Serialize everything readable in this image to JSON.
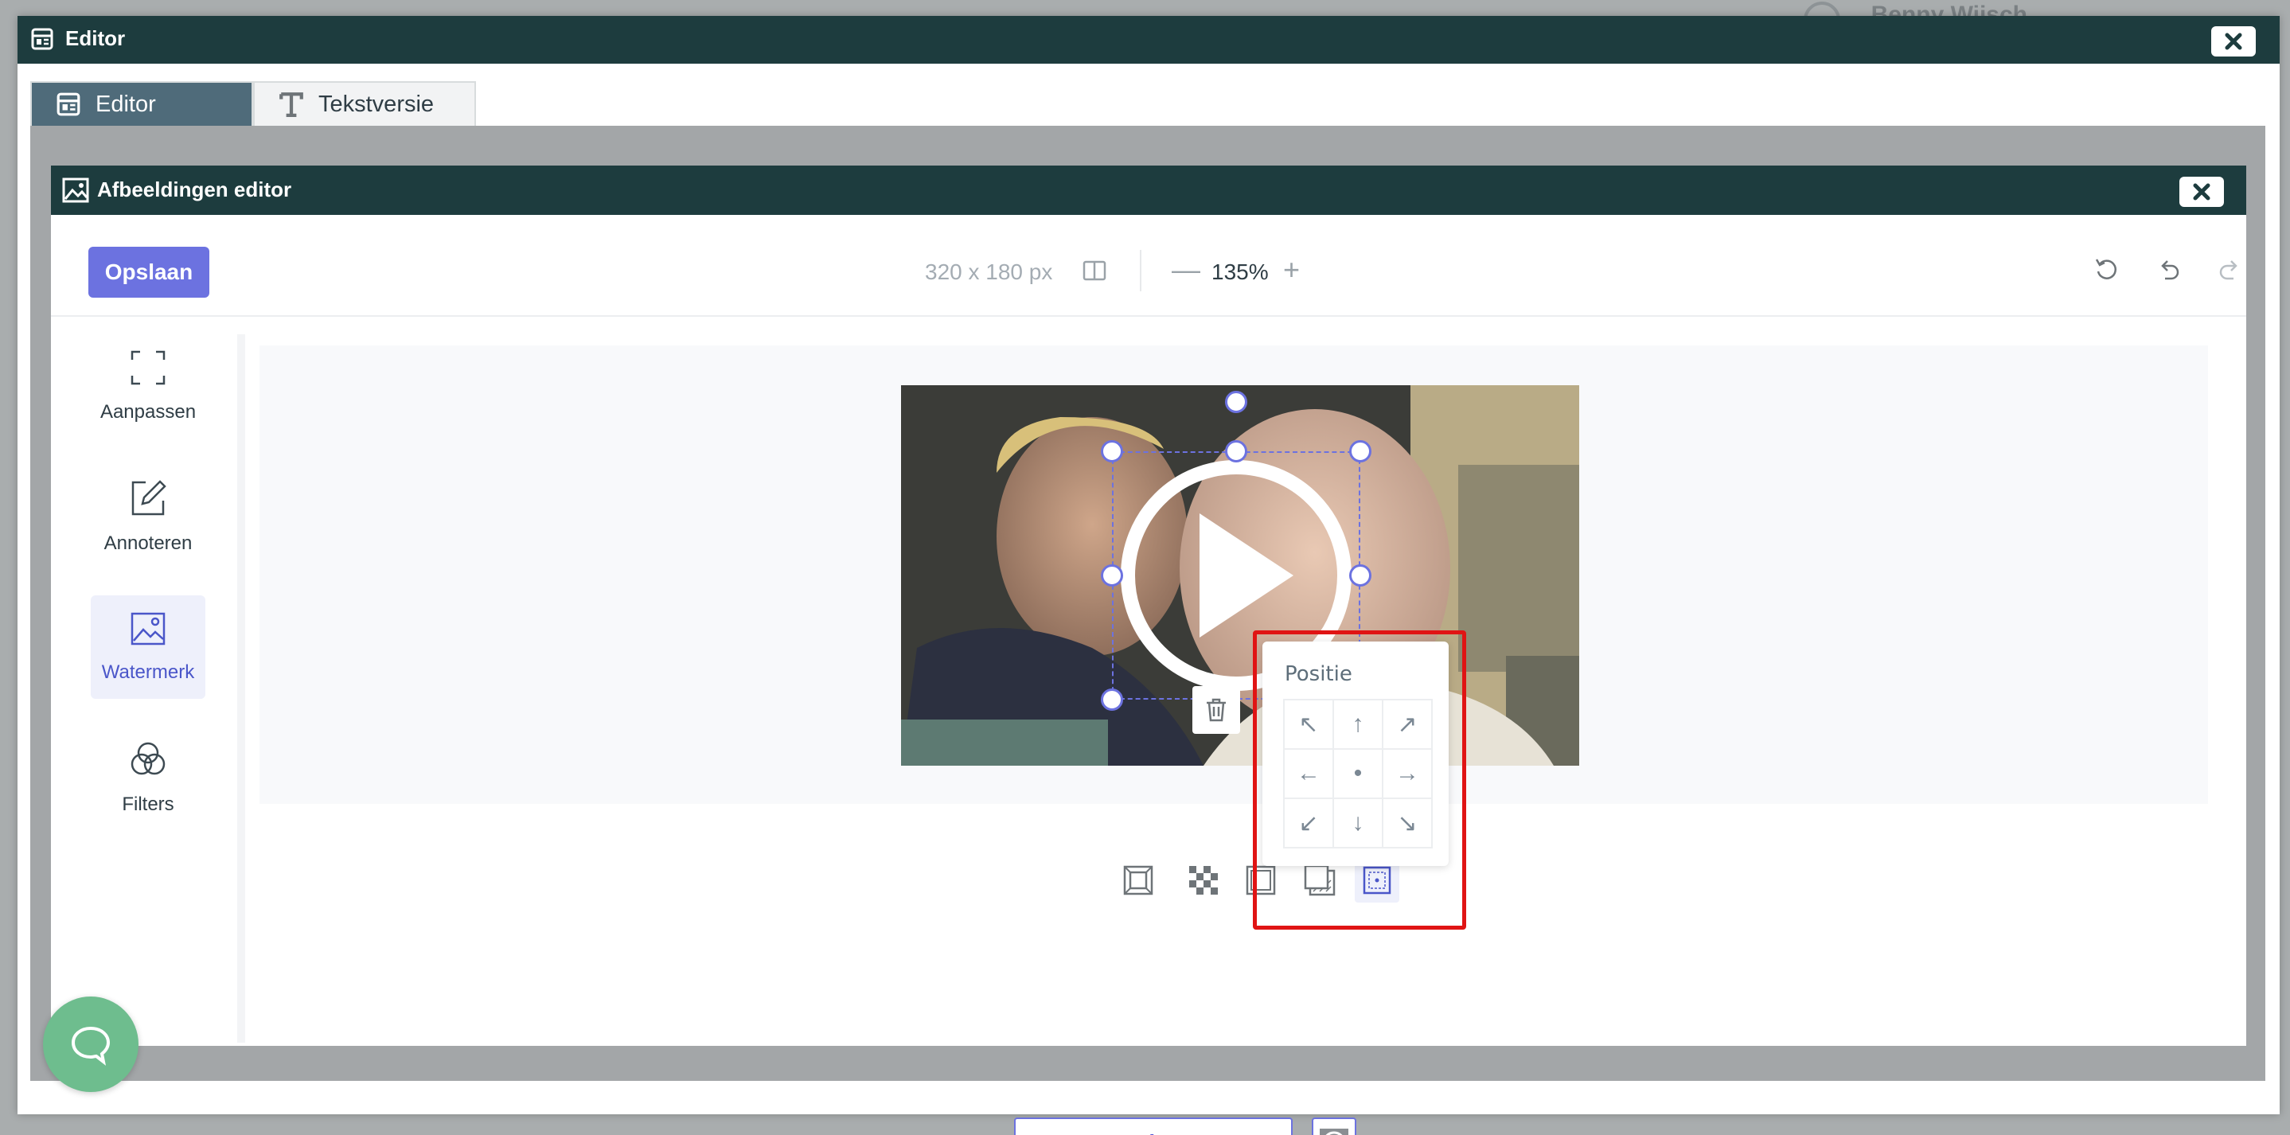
{
  "background": {
    "user_name": "Benny Wijsch"
  },
  "outer_window": {
    "title": "Editor",
    "tabs": [
      {
        "label": "Editor",
        "icon": "layout-icon",
        "active": true
      },
      {
        "label": "Tekstversie",
        "icon": "text-icon",
        "active": false
      }
    ]
  },
  "image_editor": {
    "title": "Afbeeldingen editor",
    "toolbar": {
      "save_label": "Opslaan",
      "dimensions": "320 x 180 px",
      "zoom_minus": "—",
      "zoom": "135%",
      "zoom_plus": "+"
    },
    "sidebar": [
      {
        "label": "Aanpassen",
        "icon": "crop-frame-icon",
        "active": false
      },
      {
        "label": "Annoteren",
        "icon": "edit-icon",
        "active": false
      },
      {
        "label": "Watermerk",
        "icon": "image-icon",
        "active": true
      },
      {
        "label": "Filters",
        "icon": "filters-icon",
        "active": false
      }
    ],
    "position_popup": {
      "title": "Positie",
      "cells": [
        "↖",
        "↑",
        "↗",
        "←",
        "•",
        "→",
        "↙",
        "↓",
        "↘"
      ]
    },
    "add_watermark_label": "+ Watermerk toevoegen"
  },
  "colors": {
    "title_bar": "#1d3c3e",
    "accent": "#6c72e0",
    "highlight": "#e01414",
    "chat": "#6ebd8e"
  }
}
